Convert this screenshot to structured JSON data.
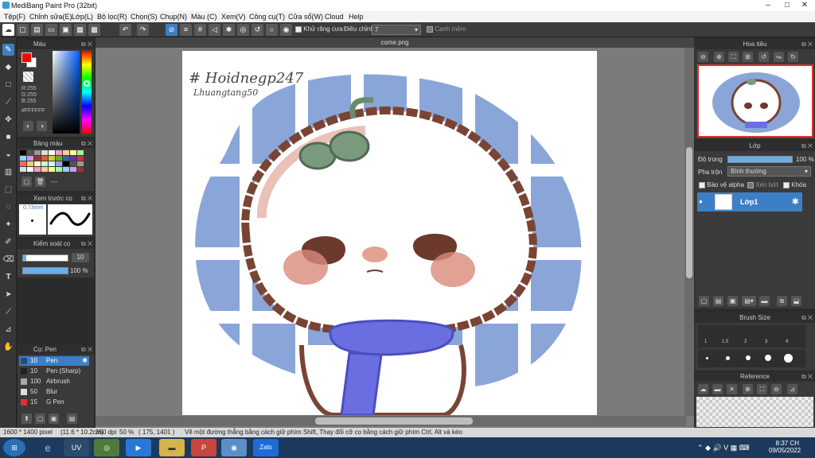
{
  "window": {
    "title": "MediBang Paint Pro (32bit)"
  },
  "menu": [
    "Tệp(F)",
    "Chỉnh sửa(E)",
    "Lớp(L)",
    "Bộ lọc(R)",
    "Chọn(S)",
    "Chụp(N)",
    "Màu (C)",
    "Xem(V)",
    "Công cụ(T)",
    "Cửa sổ(W)",
    "Cloud",
    "Help"
  ],
  "toolbar": {
    "antialias_label": "Khử răng cưa",
    "correction_label": "Điều chỉnh",
    "correction_value": "7",
    "edge_label": "Cạnh mềm"
  },
  "color_panel": {
    "title": "Màu",
    "r": "R:255",
    "g": "G:255",
    "b": "B:255",
    "hex": "#FFFFFF",
    "fg_color": "#ff0000",
    "bg_color": "#ffffff"
  },
  "palette_panel": {
    "title": "Bảng màu",
    "dash": "---"
  },
  "brush_preview": {
    "title": "Xem trước cọ",
    "size": "0.73mm"
  },
  "brush_control": {
    "title": "Kiểm soát cọ",
    "size_value": "10",
    "opacity_value": "100 %"
  },
  "brush_list": {
    "title": "Cọ: Pen",
    "items": [
      {
        "size": "10",
        "name": "Pen",
        "color": "#1f4e79"
      },
      {
        "size": "10",
        "name": "Pen (Sharp)",
        "color": "#222222"
      },
      {
        "size": "100",
        "name": "Airbrush",
        "color": "#aaaaaa"
      },
      {
        "size": "50",
        "name": "Blur",
        "color": "#dddddd"
      },
      {
        "size": "15",
        "name": "G Pen",
        "color": "#e03030"
      }
    ]
  },
  "document": {
    "tab": "come.png"
  },
  "canvas_text": {
    "line1": "# Hoidnegp247",
    "line2": "Lhuangtang50"
  },
  "navigator": {
    "title": "Hoa tiêu"
  },
  "layer_panel": {
    "title": "Lớp",
    "opacity_label": "Độ trong",
    "opacity_value": "100 %",
    "opacity": 1.0,
    "blend_label": "Pha trộn",
    "blend_value": "Bình thường",
    "protect_alpha": "Bảo vệ alpha",
    "clipping": "Xén bớt",
    "lock": "Khóa",
    "layer_name": "Lớp1"
  },
  "brush_size_panel": {
    "title": "Brush Size",
    "sizes": [
      "1",
      "1.5",
      "2",
      "3",
      "4"
    ]
  },
  "reference_panel": {
    "title": "Reference"
  },
  "status": {
    "size": "1600 * 1400 pixel",
    "cm": "(11.6 * 10.2cm)",
    "dpi": "350 dpi",
    "zoom": "50 %",
    "coords": "( 175, 1401 )",
    "hint": "Vẽ một đường thẳng bằng cách giữ phím Shift, Thay đổi cỡ cọ bằng cách giữ phím Ctrl, Alt và kéo"
  },
  "taskbar": {
    "time": "8:37 CH",
    "date": "09/05/2022",
    "zalo": "Zalo"
  }
}
